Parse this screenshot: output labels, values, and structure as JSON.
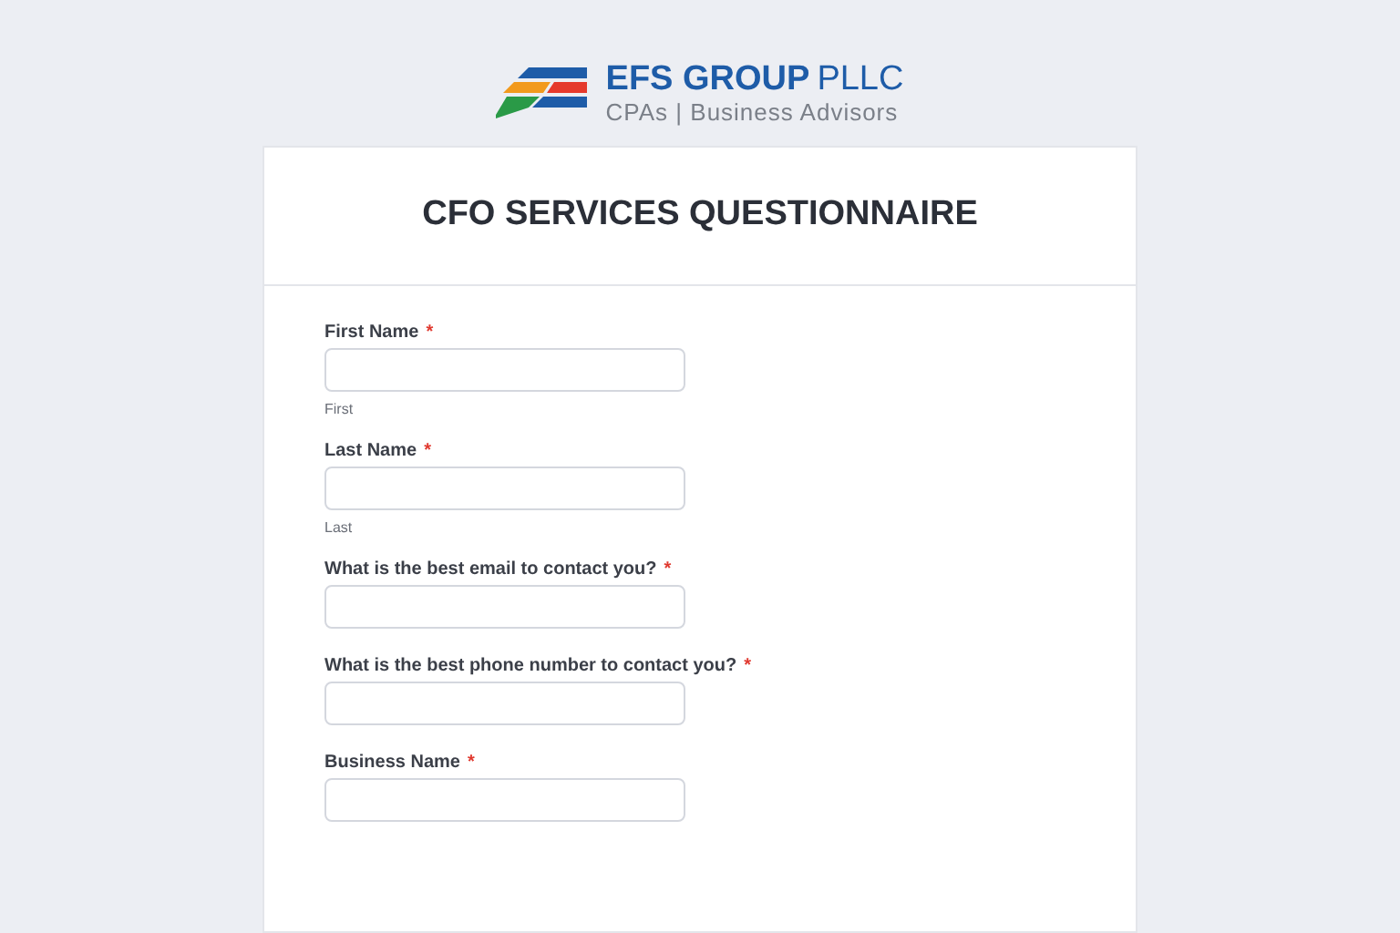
{
  "logo": {
    "name": "EFS GROUP",
    "suffix": "PLLC",
    "tagline": "CPAs | Business Advisors"
  },
  "form": {
    "title": "CFO SERVICES QUESTIONNAIRE",
    "fields": [
      {
        "label": "First Name",
        "required_mark": "*",
        "sublabel": "First"
      },
      {
        "label": "Last Name",
        "required_mark": "*",
        "sublabel": "Last"
      },
      {
        "label": "What is the best email to contact you?",
        "required_mark": "*"
      },
      {
        "label": "What is the best phone number to contact you?",
        "required_mark": "*"
      },
      {
        "label": "Business Name",
        "required_mark": "*"
      }
    ]
  }
}
